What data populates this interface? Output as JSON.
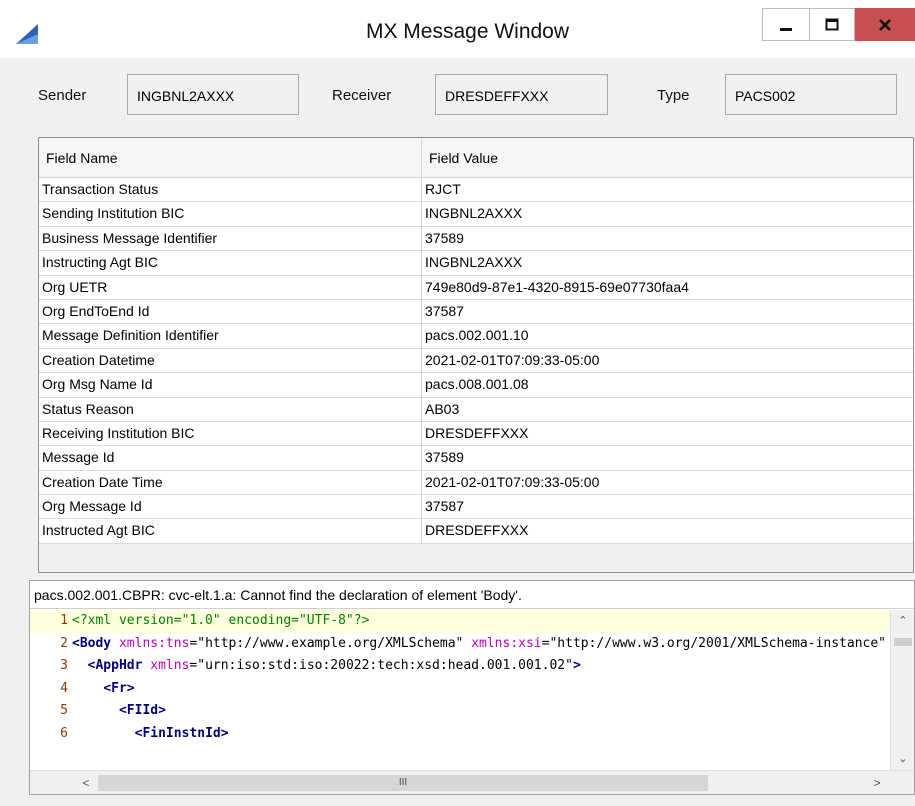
{
  "window": {
    "title": "MX Message Window"
  },
  "header": {
    "sender_label": "Sender",
    "sender_value": "INGBNL2AXXX",
    "receiver_label": "Receiver",
    "receiver_value": "DRESDEFFXXX",
    "type_label": "Type",
    "type_value": "PACS002"
  },
  "table": {
    "columns": [
      "Field Name",
      "Field Value"
    ],
    "rows": [
      [
        "Transaction Status",
        "RJCT"
      ],
      [
        "Sending Institution BIC",
        "INGBNL2AXXX"
      ],
      [
        "Business Message Identifier",
        "37589"
      ],
      [
        "Instructing Agt BIC",
        "INGBNL2AXXX"
      ],
      [
        "Org UETR",
        "749e80d9-87e1-4320-8915-69e07730faa4"
      ],
      [
        "Org EndToEnd Id",
        "37587"
      ],
      [
        "Message Definition Identifier",
        "pacs.002.001.10"
      ],
      [
        "Creation Datetime",
        "2021-02-01T07:09:33-05:00"
      ],
      [
        "Org Msg Name Id",
        "pacs.008.001.08"
      ],
      [
        "Status Reason",
        "AB03"
      ],
      [
        "Receiving Institution BIC",
        "DRESDEFFXXX"
      ],
      [
        "Message Id",
        "37589"
      ],
      [
        "Creation Date Time",
        "2021-02-01T07:09:33-05:00"
      ],
      [
        "Org Message Id",
        "37587"
      ],
      [
        "Instructed Agt BIC",
        "DRESDEFFXXX"
      ]
    ]
  },
  "validation": {
    "message": "pacs.002.001.CBPR: cvc-elt.1.a: Cannot find the declaration of element 'Body'."
  },
  "editor": {
    "lines": [
      {
        "n": "1",
        "indent": "",
        "parts": [
          [
            "decl",
            "<?xml version=\"1.0\" encoding=\"UTF-8\"?>"
          ]
        ]
      },
      {
        "n": "2",
        "indent": "",
        "parts": [
          [
            "tag",
            "<Body"
          ],
          [
            "sp",
            " "
          ],
          [
            "attr",
            "xmlns:tns"
          ],
          [
            "str",
            "=\"http://www.example.org/XMLSchema\""
          ],
          [
            "sp",
            " "
          ],
          [
            "attr",
            "xmlns:xsi"
          ],
          [
            "str",
            "=\"http://www.w3.org/2001/XMLSchema-instance\""
          ]
        ]
      },
      {
        "n": "3",
        "indent": "  ",
        "parts": [
          [
            "tag",
            "<AppHdr"
          ],
          [
            "sp",
            " "
          ],
          [
            "attr",
            "xmlns"
          ],
          [
            "str",
            "=\"urn:iso:std:iso:20022:tech:xsd:head.001.001.02\""
          ],
          [
            "tag",
            ">"
          ]
        ]
      },
      {
        "n": "4",
        "indent": "    ",
        "parts": [
          [
            "tag",
            "<Fr>"
          ]
        ]
      },
      {
        "n": "5",
        "indent": "      ",
        "parts": [
          [
            "tag",
            "<FIId>"
          ]
        ]
      },
      {
        "n": "6",
        "indent": "        ",
        "parts": [
          [
            "tag",
            "<FinInstnId>"
          ]
        ]
      }
    ]
  },
  "scrollbar": {
    "grip": "III"
  },
  "icons": {
    "app": "app-logo-icon",
    "minimize": "minimize-icon",
    "maximize": "maximize-icon",
    "close": "close-icon"
  },
  "colors": {
    "close_button": "#c75050",
    "line_highlight": "#ffffdd",
    "line_numbers": "#8b3a00"
  }
}
